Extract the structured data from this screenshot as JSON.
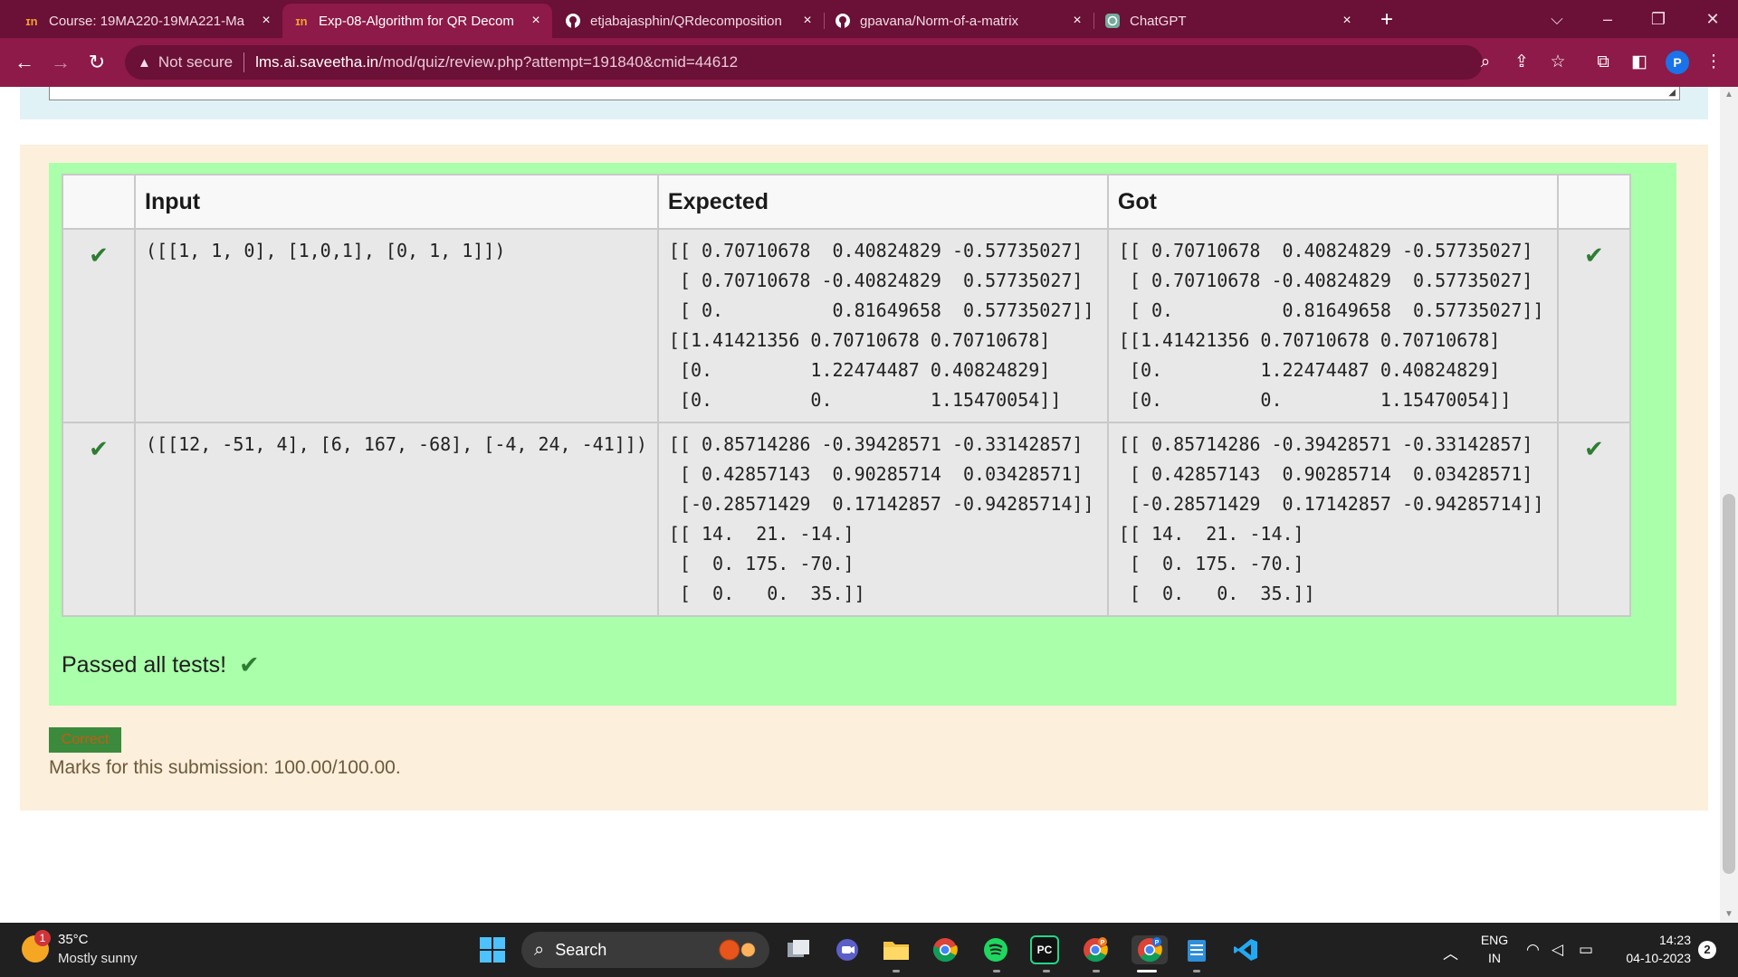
{
  "browser": {
    "tabs": [
      {
        "title": "Course: 19MA220-19MA221-Ma",
        "icon": "moodle-icon",
        "active": false
      },
      {
        "title": "Exp-08-Algorithm for QR Decom",
        "icon": "moodle-icon",
        "active": true
      },
      {
        "title": "etjabajasphin/QRdecomposition",
        "icon": "github-icon",
        "active": false
      },
      {
        "title": "gpavana/Norm-of-a-matrix",
        "icon": "github-icon",
        "active": false
      },
      {
        "title": "ChatGPT",
        "icon": "chatgpt-icon",
        "active": false
      }
    ],
    "tab_icon_text": {
      "moodle": "ɪn",
      "close": "×"
    },
    "address": {
      "security_label": "Not secure",
      "host": "lms.ai.saveetha.in",
      "path": "/mod/quiz/review.php?attempt=191840&cmid=44612"
    },
    "profile_initial": "P",
    "theme_color": "#8d1a48"
  },
  "result_table": {
    "headers": {
      "input": "Input",
      "expected": "Expected",
      "got": "Got"
    },
    "rows": [
      {
        "input": "([[1, 1, 0], [1,0,1], [0, 1, 1]])",
        "expected": "[[ 0.70710678  0.40824829 -0.57735027]\n [ 0.70710678 -0.40824829  0.57735027]\n [ 0.          0.81649658  0.57735027]]\n[[1.41421356 0.70710678 0.70710678]\n [0.         1.22474487 0.40824829]\n [0.         0.         1.15470054]]",
        "got": "[[ 0.70710678  0.40824829 -0.57735027]\n [ 0.70710678 -0.40824829  0.57735027]\n [ 0.          0.81649658  0.57735027]]\n[[1.41421356 0.70710678 0.70710678]\n [0.         1.22474487 0.40824829]\n [0.         0.         1.15470054]]"
      },
      {
        "input": "([[12, -51, 4], [6, 167, -68], [-4, 24, -41]])",
        "expected": "[[ 0.85714286 -0.39428571 -0.33142857]\n [ 0.42857143  0.90285714  0.03428571]\n [-0.28571429  0.17142857 -0.94285714]]\n[[ 14.  21. -14.]\n [  0. 175. -70.]\n [  0.   0.  35.]]",
        "got": "[[ 0.85714286 -0.39428571 -0.33142857]\n [ 0.42857143  0.90285714  0.03428571]\n [-0.28571429  0.17142857 -0.94285714]]\n[[ 14.  21. -14.]\n [  0. 175. -70.]\n [  0.   0.  35.]]"
      }
    ],
    "check_glyph": "✔"
  },
  "summary": {
    "passed_text": "Passed all tests!",
    "badge": "Correct",
    "marks": "Marks for this submission: 100.00/100.00."
  },
  "taskbar": {
    "weather_temp": "35°C",
    "weather_desc": "Mostly sunny",
    "weather_badge": "1",
    "search_label": "Search",
    "lang_top": "ENG",
    "lang_bottom": "IN",
    "time": "14:23",
    "date": "04-10-2023",
    "notification_count": "2",
    "pycharm_label": "PC",
    "chrome_profile_badges": [
      "P",
      "P"
    ]
  },
  "colors": {
    "pass_green": "#aaffaa",
    "outcome_bg": "#fcefdc",
    "check_green": "#2e7d32"
  }
}
